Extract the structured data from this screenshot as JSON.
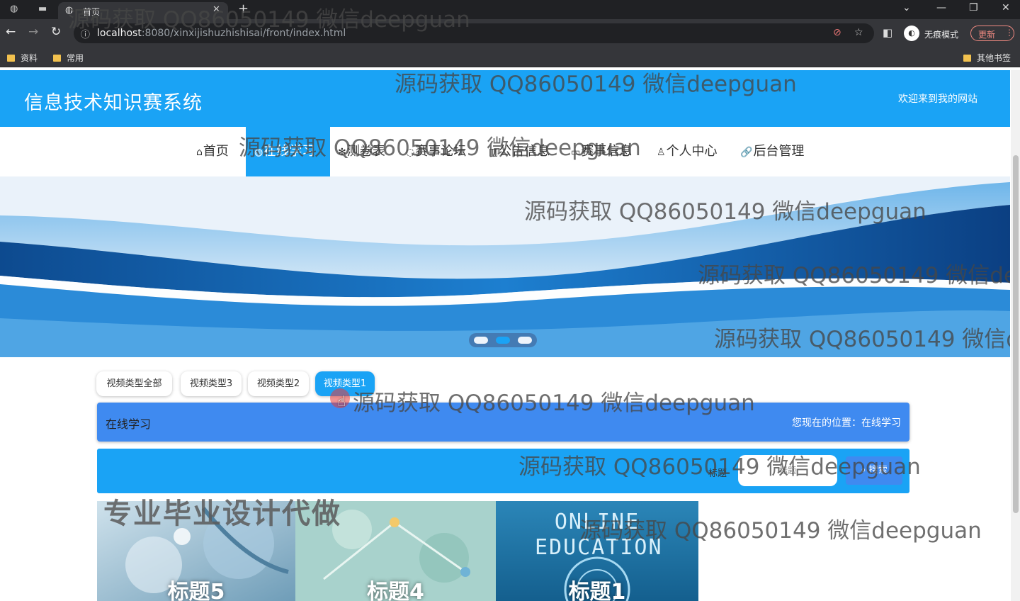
{
  "browser": {
    "tab_title": "首页",
    "url_host": "localhost",
    "url_rest": ":8080/xinxijishuzhishisai/front/index.html",
    "incognito_label": "无痕模式",
    "update_label": "更新",
    "bookmarks": [
      "资料",
      "常用"
    ],
    "other_bookmarks": "其他书签"
  },
  "site": {
    "title": "信息技术知识赛系统",
    "welcome": "欢迎来到我的网站"
  },
  "nav": [
    {
      "icon": "home-icon",
      "glyph": "⌂",
      "label": "首页"
    },
    {
      "icon": "globe-icon",
      "glyph": "◍",
      "label": "在线学习",
      "active": true
    },
    {
      "icon": "asterisk-icon",
      "glyph": "✻",
      "label": "测卷表"
    },
    {
      "icon": "forum-icon",
      "glyph": "◌",
      "label": "赛事论坛"
    },
    {
      "icon": "notice-icon",
      "glyph": "▥",
      "label": "公告信息"
    },
    {
      "icon": "message-icon",
      "glyph": "▭",
      "label": "赛事信息"
    },
    {
      "icon": "user-icon",
      "glyph": "♙",
      "label": "个人中心"
    },
    {
      "icon": "link-icon",
      "glyph": "🔗",
      "label": "后台管理"
    }
  ],
  "carousel": {
    "slide_count": 3,
    "active_index": 1
  },
  "filters": [
    {
      "label": "视频类型全部",
      "active": false
    },
    {
      "label": "视频类型3",
      "active": false
    },
    {
      "label": "视频类型2",
      "active": false
    },
    {
      "label": "视频类型1",
      "active": true
    }
  ],
  "location": {
    "title": "在线学习",
    "breadcrumb": "您现在的位置：在线学习"
  },
  "search": {
    "label": "标题",
    "placeholder": "标题",
    "button": "搜索"
  },
  "cards": [
    {
      "title": "标题5"
    },
    {
      "title": "标题4"
    },
    {
      "title": "标题1",
      "image_text": "ONLINE EDUCATION"
    }
  ],
  "watermarks": {
    "text": "源码获取 QQ86050149 微信deepguan",
    "promo": "专业毕业设计代做"
  },
  "colors": {
    "header_blue": "#1aa3f5",
    "accent_blue": "#3f8af0",
    "browser_dark": "#35363a"
  }
}
